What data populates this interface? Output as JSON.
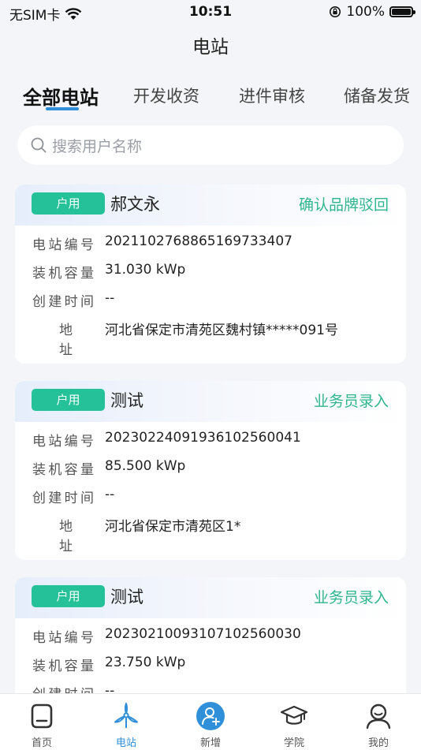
{
  "status_bar": {
    "carrier": "无SIM卡",
    "time": "10:51",
    "battery": "100%"
  },
  "page": {
    "title": "电站"
  },
  "tabs": [
    {
      "label": "全部电站",
      "active": true
    },
    {
      "label": "开发收资",
      "active": false
    },
    {
      "label": "进件审核",
      "active": false
    },
    {
      "label": "储备发货",
      "active": false
    }
  ],
  "search": {
    "placeholder": "搜索用户名称"
  },
  "field_labels": {
    "station_no": "电站编号",
    "capacity": "装机容量",
    "created": "创建时间",
    "address": "地 址"
  },
  "stations": [
    {
      "badge": "户用",
      "name": "郝文永",
      "status": "确认品牌驳回",
      "station_no": "20211027688651697334​07",
      "capacity": "31.030 kWp",
      "created": "--",
      "address": "河北省保定市清苑区魏村镇*****091号"
    },
    {
      "badge": "户用",
      "name": "测试",
      "status": "业务员录入",
      "station_no": "2023022409193610256004​1",
      "capacity": "85.500 kWp",
      "created": "--",
      "address": "河北省保定市清苑区1*"
    },
    {
      "badge": "户用",
      "name": "测试",
      "status": "业务员录入",
      "station_no": "2023021009310710256003​0",
      "capacity": "23.750 kWp",
      "created": "--",
      "address": ""
    }
  ],
  "tabbar": [
    {
      "label": "首页",
      "icon": "home-icon",
      "active": false
    },
    {
      "label": "电站",
      "icon": "wind-turbine-icon",
      "active": true
    },
    {
      "label": "新增",
      "icon": "add-user-icon",
      "active": false
    },
    {
      "label": "学院",
      "icon": "graduation-cap-icon",
      "active": false
    },
    {
      "label": "我的",
      "icon": "profile-icon",
      "active": false
    }
  ],
  "colors": {
    "accent_blue": "#2f8fd8",
    "badge_green": "#25c29a",
    "status_green": "#2fb58e",
    "background": "#f3f5f9"
  },
  "battery_level": 1.0
}
